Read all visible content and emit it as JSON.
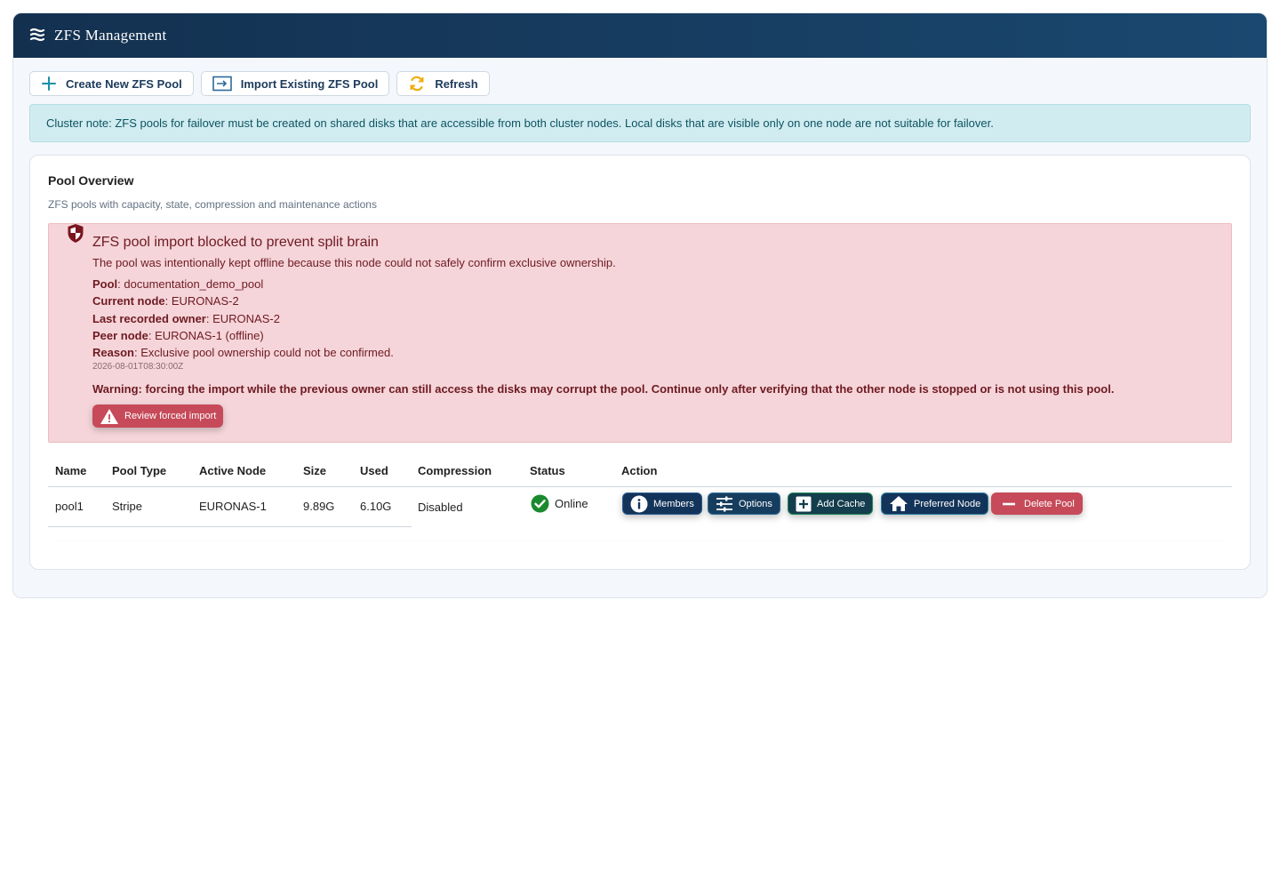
{
  "app": {
    "title": "ZFS  Management",
    "logo_icon": "zfs-layers-icon"
  },
  "toolbar": {
    "create_label": "Create New ZFS Pool",
    "import_label": "Import Existing ZFS Pool",
    "refresh_label": "Refresh"
  },
  "cluster_note": "Cluster note: ZFS pools for failover must be created on shared disks that are accessible from both cluster nodes. Local disks that are visible only on one node are not suitable for failover.",
  "overview": {
    "title": "Pool Overview",
    "subtitle": "ZFS pools with capacity, state, compression and maintenance actions"
  },
  "alert": {
    "heading": "ZFS pool import blocked to prevent split brain",
    "intro": "The pool was intentionally kept offline because this node could not safely confirm exclusive ownership.",
    "facts": [
      {
        "label": "Pool",
        "value": ": documentation_demo_pool"
      },
      {
        "label": "Current node",
        "value": ": EURONAS-2"
      },
      {
        "label": "Last recorded owner",
        "value": ": EURONAS-2"
      },
      {
        "label": "Peer node",
        "value": ": EURONAS-1 (offline)"
      },
      {
        "label": "Reason",
        "value": ": Exclusive pool ownership could not be confirmed."
      }
    ],
    "timestamp": "2026-08-01T08:30:00Z",
    "warning": "Warning: forcing the import while the previous owner can still access the disks may corrupt the pool. Continue only after verifying that the other node is stopped or is not using this pool.",
    "review_button": "Review forced import"
  },
  "table": {
    "headers": [
      "Name",
      "Pool Type",
      "Active Node",
      "Size",
      "Used",
      "Compression",
      "Status",
      "Action"
    ],
    "rows": [
      {
        "name": "pool1",
        "type": "Stripe",
        "node": "EURONAS-1",
        "size": "9.89G",
        "used": "6.10G",
        "compression": "Disabled",
        "status": "Online",
        "actions": {
          "members": "Members",
          "options": "Options",
          "add_cache": "Add Cache",
          "preferred_node": "Preferred Node",
          "delete_pool": "Delete Pool"
        }
      }
    ]
  },
  "colors": {
    "header_start": "#13304f",
    "header_end": "#1a4870",
    "info_bg": "#d1ecf1",
    "danger_bg": "#f5d5d9",
    "danger_text": "#6e1a22",
    "action_dark": "#14345a",
    "danger_button": "#c64a59",
    "online_green": "#1a8a2e"
  }
}
